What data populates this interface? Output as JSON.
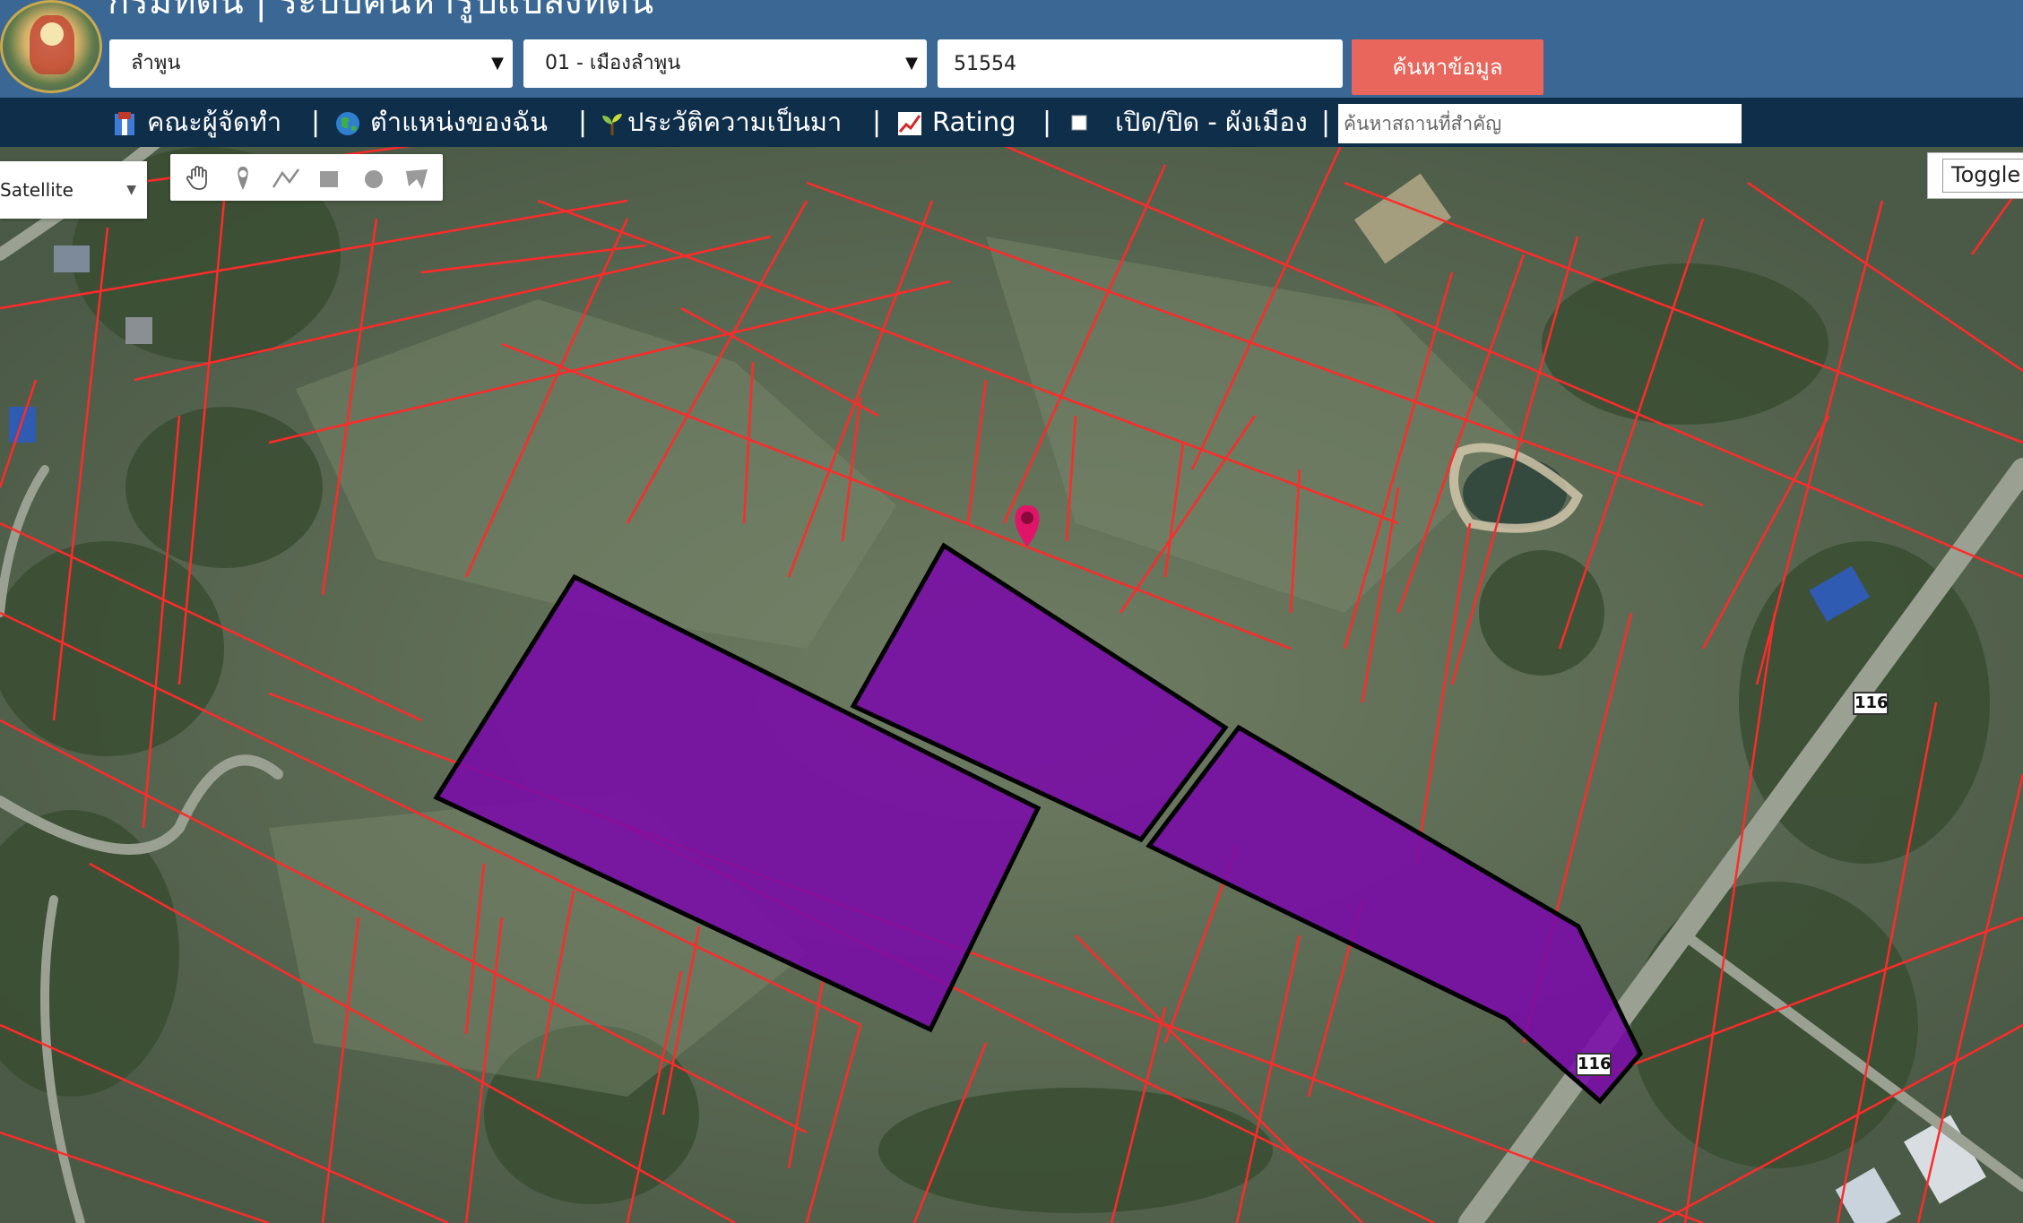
{
  "header": {
    "title": "กรมที่ดิน | ระบบค้นหารูปแปลงที่ดิน",
    "province_select": "ลำพูน",
    "district_select": "01 - เมืองลำพูน",
    "parcel_number": "51554",
    "search_button": "ค้นหาข้อมูล"
  },
  "nav": {
    "items": [
      {
        "label": "คณะผู้จัดทำ",
        "icon": "book-icon"
      },
      {
        "label": "ตำแหน่งของฉัน",
        "icon": "globe-icon"
      },
      {
        "label": "ประวัติความเป็นมา",
        "icon": "sprout-icon"
      },
      {
        "label": "Rating",
        "icon": "chart-icon"
      },
      {
        "label": "เปิด/ปิด - ผังเมือง",
        "icon": "checkbox-icon"
      }
    ],
    "separator": "|",
    "place_search_placeholder": "ค้นหาสถานที่สำคัญ"
  },
  "map": {
    "map_type": "Satellite",
    "toggle_label": "Toggle",
    "draw_tools": [
      "hand-icon",
      "marker-icon",
      "polyline-icon",
      "rectangle-icon",
      "circle-icon",
      "polygon-icon"
    ],
    "road_shields": [
      "116",
      "116"
    ],
    "colors": {
      "parcel_border": "#ff2a2a",
      "highlight_fill": "#7a0aa8",
      "highlight_stroke": "#000000",
      "marker": "#e0156a"
    }
  }
}
